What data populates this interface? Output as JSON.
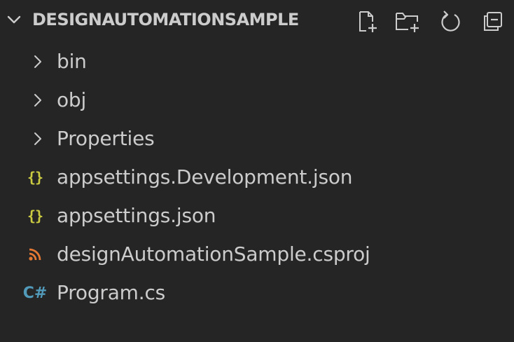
{
  "explorer": {
    "title": "DESIGNAUTOMATIONSAMPLE",
    "actions": [
      {
        "name": "new-file-icon"
      },
      {
        "name": "new-folder-icon"
      },
      {
        "name": "refresh-icon"
      },
      {
        "name": "collapse-all-icon"
      }
    ],
    "items": [
      {
        "label": "bin",
        "kind": "folder"
      },
      {
        "label": "obj",
        "kind": "folder"
      },
      {
        "label": "Properties",
        "kind": "folder"
      },
      {
        "label": "appsettings.Development.json",
        "kind": "json",
        "icon_text": "{}"
      },
      {
        "label": "appsettings.json",
        "kind": "json",
        "icon_text": "{}"
      },
      {
        "label": "designAutomationSample.csproj",
        "kind": "rss"
      },
      {
        "label": "Program.cs",
        "kind": "csharp",
        "icon_text": "C#"
      }
    ]
  },
  "colors": {
    "background": "#252526",
    "text": "#cccccc",
    "json_icon": "#cbcb41",
    "rss_icon": "#e37933",
    "csharp_icon": "#519aba"
  }
}
